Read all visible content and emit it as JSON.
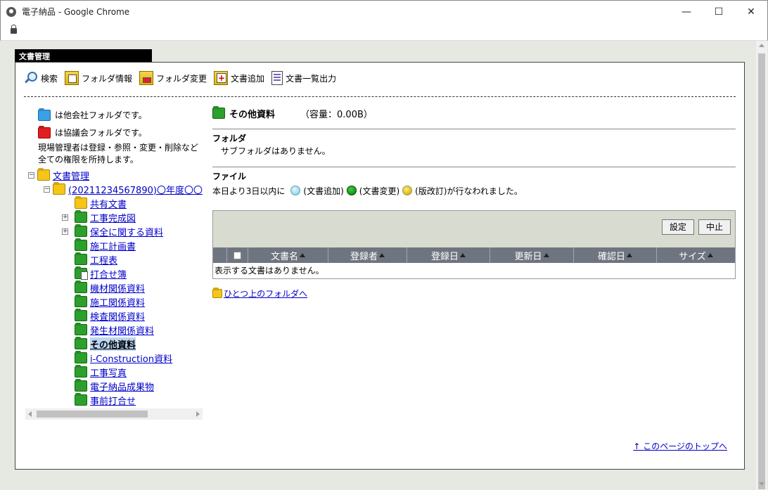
{
  "window": {
    "title": "電子納品 - Google Chrome",
    "minimize": "—",
    "maximize": "☐",
    "close": "✕"
  },
  "panel": {
    "tab_title": "文書管理"
  },
  "toolbar": {
    "search": "検索",
    "folder_info": "フォルダ情報",
    "folder_change": "フォルダ変更",
    "add_document": "文書追加",
    "export_list": "文書一覧出力"
  },
  "legend": {
    "other_company": "は他会社フォルダです。",
    "council": "は協議会フォルダです。",
    "note_line1": "現場管理者は登録・参照・変更・削除など",
    "note_line2": "全ての権限を所持します。"
  },
  "tree": {
    "root": "文書管理",
    "project": "(20211234567890)〇年度〇〇〇〇",
    "items": [
      "共有文書",
      "工事完成図",
      "保全に関する資料",
      "施工計画書",
      "工程表",
      "打合せ簿",
      "機材関係資料",
      "施工関係資料",
      "検査関係資料",
      "発生材関係資料",
      "その他資料",
      "i-Construction資料",
      "工事写真",
      "電子納品成果物",
      "事前打合せ"
    ]
  },
  "current": {
    "name": "その他資料",
    "capacity": "（容量：0.00B）",
    "folder_heading": "フォルダ",
    "folder_empty": "サブフォルダはありません。",
    "file_heading": "ファイル",
    "notice_prefix": "本日より3日以内に",
    "notice_add": "(文書追加)",
    "notice_change": "(文書変更)",
    "notice_revise": "(版改訂)が行なわれました。"
  },
  "doc_table": {
    "settings_button": "設定",
    "cancel_button": "中止",
    "columns": [
      "文書名",
      "登録者",
      "登録日",
      "更新日",
      "確認日",
      "サイズ"
    ],
    "empty_text": "表示する文書はありません。"
  },
  "links": {
    "up_folder": "ひとつ上のフォルダへ",
    "page_top": "このページのトップへ"
  },
  "colors": {
    "other_company_folder": "#3aa0e8",
    "council_folder": "#e02020",
    "table_header": "#6f7580"
  }
}
